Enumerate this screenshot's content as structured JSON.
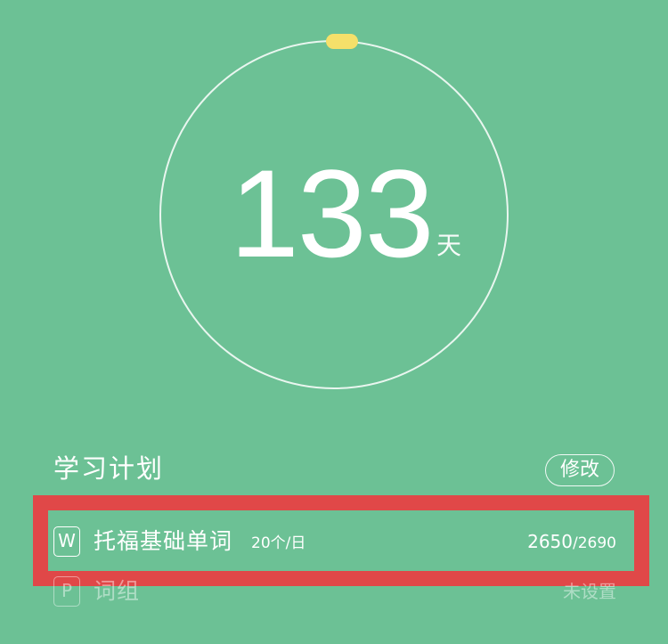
{
  "countdown": {
    "value": "133",
    "unit": "天"
  },
  "plan": {
    "title": "学习计划",
    "edit_label": "修改"
  },
  "items": [
    {
      "icon_letter": "W",
      "name": "托福基础单词",
      "rate": "20个/日",
      "progress_done": "2650",
      "progress_total": "/2690"
    },
    {
      "icon_letter": "P",
      "name": "词组",
      "status": "未设置"
    }
  ],
  "colors": {
    "background": "#6cc195",
    "knob": "#f5e06a",
    "highlight": "#e04848"
  }
}
